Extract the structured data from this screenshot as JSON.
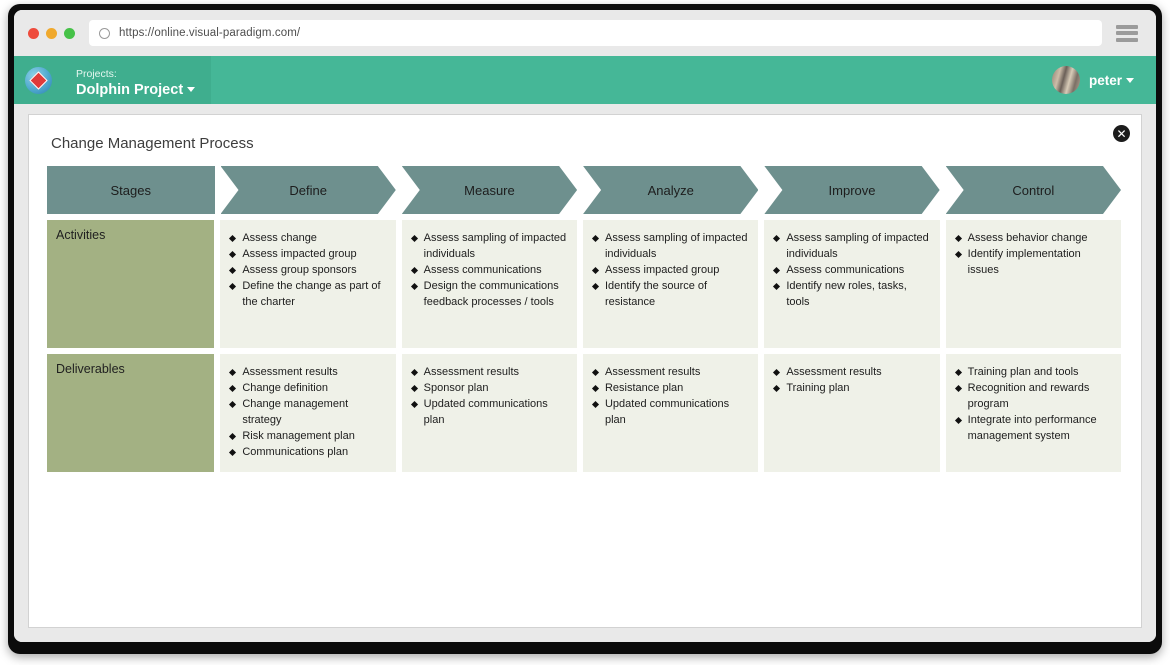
{
  "browser": {
    "url": "https://online.visual-paradigm.com/",
    "menu_icon": "hamburger-menu-icon",
    "spinner_icon": "loading-circle-icon",
    "traffic_lights": [
      "close",
      "minimize",
      "maximize"
    ]
  },
  "appbar": {
    "logo_icon": "visual-paradigm-logo-icon",
    "projects_label": "Projects:",
    "project_name": "Dolphin Project",
    "project_caret_icon": "chevron-down-icon",
    "username": "peter",
    "user_caret_icon": "chevron-down-icon",
    "avatar_icon": "user-avatar",
    "bar_color": "#45b797"
  },
  "dialog": {
    "title": "Change Management Process",
    "close_icon": "close-x-icon",
    "close_label": "✕"
  },
  "chart_data": {
    "type": "table",
    "title": "Change Management Process",
    "header_color": "#6e908e",
    "label_color": "#a3b183",
    "cell_color": "#eff1e8",
    "columns": [
      "Stages",
      "Define",
      "Measure",
      "Analyze",
      "Improve",
      "Control"
    ],
    "row_labels": [
      "Activities",
      "Deliverables"
    ],
    "rows": [
      {
        "label": "Activities",
        "cells": [
          [
            "Assess change",
            "Assess impacted group",
            "Assess group sponsors",
            "Define the change as part of the charter"
          ],
          [
            "Assess sampling of impacted individuals",
            "Assess communications",
            "Design the communications feedback processes / tools"
          ],
          [
            "Assess sampling of impacted individuals",
            "Assess impacted group",
            "Identify the source of resistance"
          ],
          [
            "Assess sampling of impacted individuals",
            "Assess communications",
            "Identify new roles, tasks, tools"
          ],
          [
            "Assess behavior change",
            "Identify implementation issues"
          ]
        ]
      },
      {
        "label": "Deliverables",
        "cells": [
          [
            "Assessment results",
            "Change definition",
            "Change management strategy",
            "Risk management plan",
            "Communications plan"
          ],
          [
            "Assessment results",
            "Sponsor plan",
            "Updated communications plan"
          ],
          [
            "Assessment results",
            "Resistance plan",
            "Updated communications plan"
          ],
          [
            "Assessment results",
            "Training plan"
          ],
          [
            "Training plan and tools",
            "Recognition and rewards program",
            "Integrate into performance management system"
          ]
        ]
      }
    ]
  }
}
